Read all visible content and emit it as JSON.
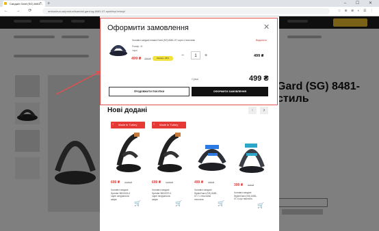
{
  "browser": {
    "tab_title": "Сандалі Gard (SG) 8481-...",
    "tab_close": "×",
    "new_tab": "+",
    "window_controls": "–  ☐  ✕",
    "nav_icons": "←  →  ⟳",
    "url": "ambushua.ua/product/sandali-gard-sg-8481-07-spokiinyi-tekstyl",
    "ext_icons": "☆ ⊕ ⊗ ◐ ☰ ⋮"
  },
  "page": {
    "product_title_partial": "Gard (SG) 8481-\nстиль"
  },
  "modal": {
    "title": "Оформити замовлення",
    "close": "✕",
    "item": {
      "description": "Чоловічі сандалі пляжні Gard (SG) 8481-07 чорні з текстилю",
      "size": "Розмір: 41",
      "color": "чорні",
      "price": "499 ₴",
      "old_price": "799 ₴",
      "badge": "Знижка -38%",
      "quantity": "1",
      "line_total": "499 ₴",
      "remove": "Видалити",
      "minus": "−",
      "plus": "+"
    },
    "sum_label": "Сума",
    "sum": "499 ₴",
    "continue_button": "ПРОДОВЖИТИ ПОКУПКИ",
    "checkout_button": "ОФОРМИТИ ЗАМОВЛЕННЯ",
    "new_title": "Нові додані",
    "prev": "‹",
    "next": "›"
  },
  "products": [
    {
      "flag": "Made in Turkey",
      "price": "699 ₴",
      "old": "1199 ₴",
      "name": "Чоловічі сандалі Sprinter 9822015-0 чорні натуральна шкіра",
      "accent": "#c77b3a"
    },
    {
      "flag": "Made in Turkey",
      "price": "699 ₴",
      "old": "1199 ₴",
      "name": "Чоловічі сандалі Sprinter 9822237-0 чорні натуральна шкіра",
      "accent": "#c77b3a"
    },
    {
      "flag": "",
      "price": "499 ₴",
      "old": "799 ₴",
      "name": "Чоловічі сандалі StylenGard (SG) 8481-07-7 з текстилю текстиль",
      "accent": "#2c7be5"
    },
    {
      "flag": "",
      "price": "399 ₴",
      "old": "599 ₴",
      "name": "Чоловічі сандалі StylenGard (SG) 8481-07-3 сірі текстиль",
      "accent": "#2aa7c9"
    }
  ],
  "icons": {
    "cart": "cart-icon",
    "close": "close-icon",
    "flag": "turkey-flag-icon"
  },
  "colors": {
    "accent_red": "#e53935",
    "badge_yellow": "#f4e23c",
    "checkout_black": "#111111",
    "frame_red": "#e0504e"
  }
}
